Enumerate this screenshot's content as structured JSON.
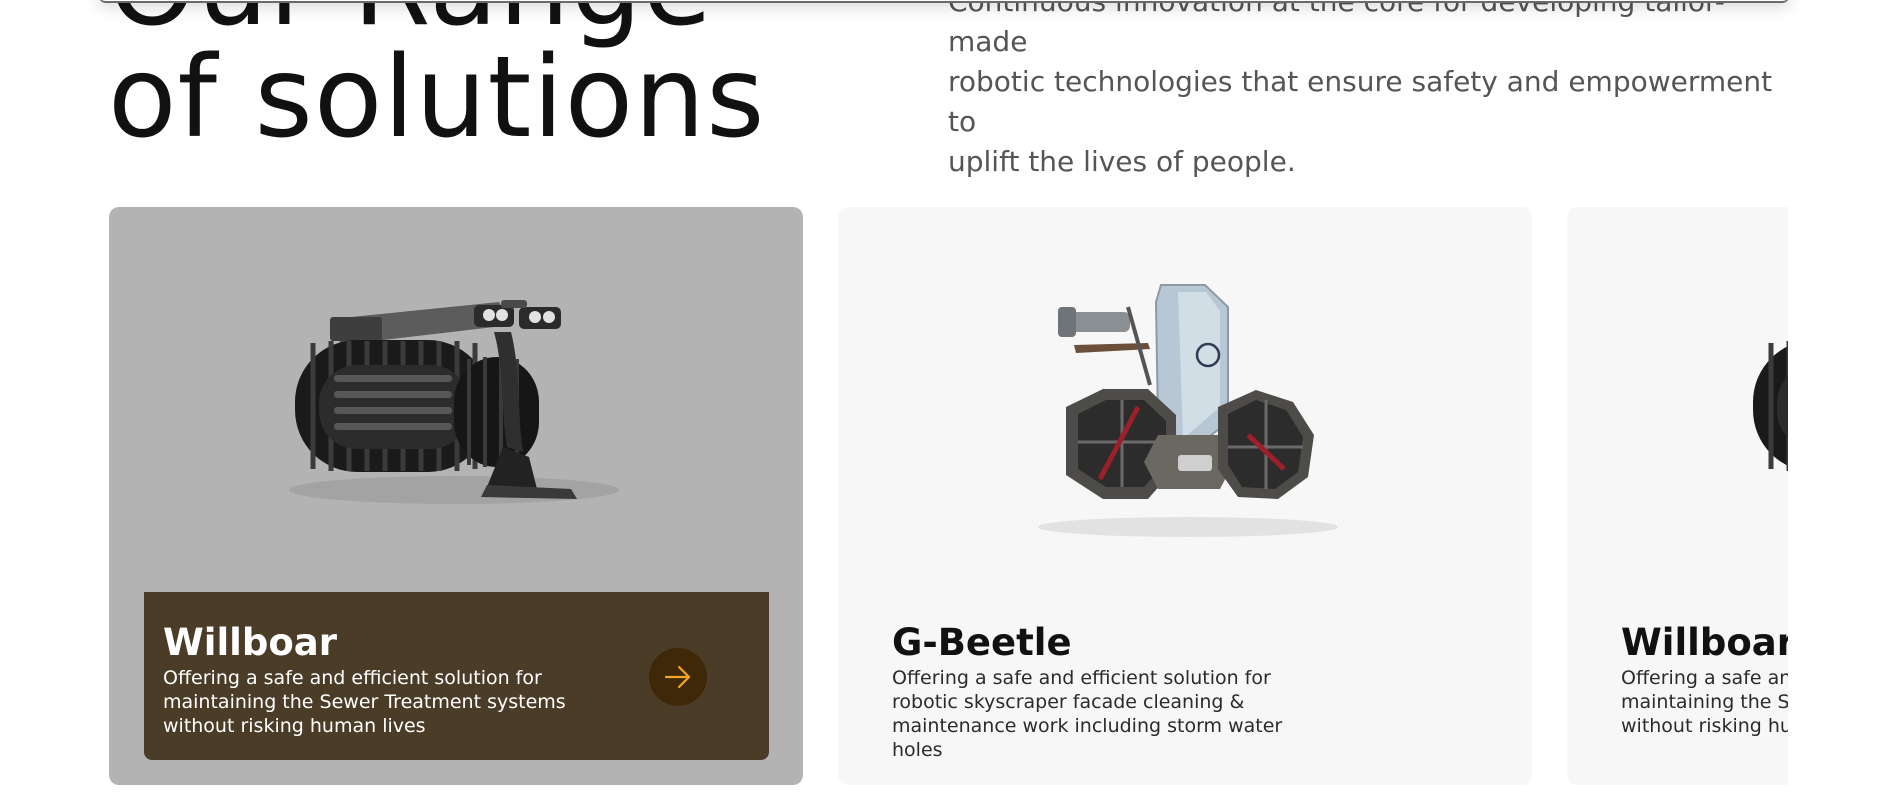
{
  "section": {
    "headline_lines": [
      "Our Range",
      "of solutions"
    ],
    "intro_lines": [
      "Continuous innovation at the core for developing tailor-made",
      "robotic technologies that ensure safety and empowerment to",
      "uplift the lives of people."
    ]
  },
  "cards": [
    {
      "title": "Willboar",
      "description_lines": [
        "Offering a safe and efficient solution for",
        "maintaining the Sewer Treatment systems",
        "without risking human lives"
      ],
      "image": "sewer-robot",
      "action_icon": "arrow-right-icon",
      "state": "active"
    },
    {
      "title": "G-Beetle",
      "description_lines": [
        "Offering a safe and efficient solution for",
        "robotic skyscraper facade cleaning &",
        "maintenance work including storm water holes"
      ],
      "image": "facade-cleaning-robot",
      "state": "default"
    },
    {
      "title": "Willboar",
      "description_lines": [
        "Offering a safe and efficient solution for",
        "maintaining the Sewer Treatment systems",
        "without risking human lives"
      ],
      "image": "sewer-robot",
      "state": "default"
    }
  ],
  "colors": {
    "active_card_bg": "#b3b3b3",
    "active_panel_bg": "#4b3c28",
    "arrow_button_bg": "#3e2808",
    "arrow_color": "#f2a623",
    "card_bg": "#f7f7f7"
  }
}
